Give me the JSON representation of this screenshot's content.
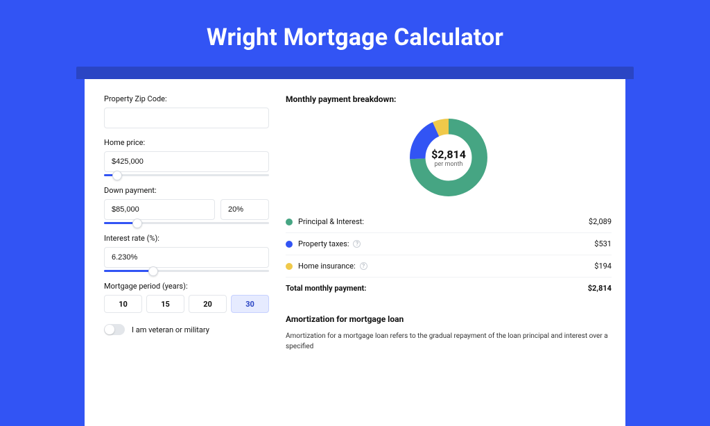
{
  "title": "Wright Mortgage Calculator",
  "form": {
    "zip": {
      "label": "Property Zip Code:",
      "value": ""
    },
    "home_price": {
      "label": "Home price:",
      "value": "$425,000",
      "slider_pct": 8
    },
    "down_payment": {
      "label": "Down payment:",
      "amount": "$85,000",
      "percent": "20%",
      "slider_pct": 20
    },
    "interest": {
      "label": "Interest rate (%):",
      "value": "6.230%",
      "slider_pct": 30
    },
    "period": {
      "label": "Mortgage period (years):",
      "options": [
        "10",
        "15",
        "20",
        "30"
      ],
      "active_index": 3
    },
    "veteran": {
      "label": "I am veteran or military",
      "checked": false
    }
  },
  "breakdown": {
    "title": "Monthly payment breakdown:",
    "center_value": "$2,814",
    "center_sub": "per month",
    "items": [
      {
        "label": "Principal & Interest:",
        "value": "$2,089",
        "color": "#46a583",
        "has_info": false
      },
      {
        "label": "Property taxes:",
        "value": "$531",
        "color": "#3254f4",
        "has_info": true
      },
      {
        "label": "Home insurance:",
        "value": "$194",
        "color": "#f0c94a",
        "has_info": true
      }
    ],
    "total": {
      "label": "Total monthly payment:",
      "value": "$2,814"
    }
  },
  "amort": {
    "title": "Amortization for mortgage loan",
    "text": "Amortization for a mortgage loan refers to the gradual repayment of the loan principal and interest over a specified"
  },
  "chart_data": {
    "type": "pie",
    "title": "Monthly payment breakdown",
    "series": [
      {
        "name": "Principal & Interest",
        "value": 2089,
        "color": "#46a583"
      },
      {
        "name": "Property taxes",
        "value": 531,
        "color": "#3254f4"
      },
      {
        "name": "Home insurance",
        "value": 194,
        "color": "#f0c94a"
      }
    ],
    "total": 2814,
    "center_label": "$2,814 per month",
    "donut_inner_ratio": 0.62
  }
}
